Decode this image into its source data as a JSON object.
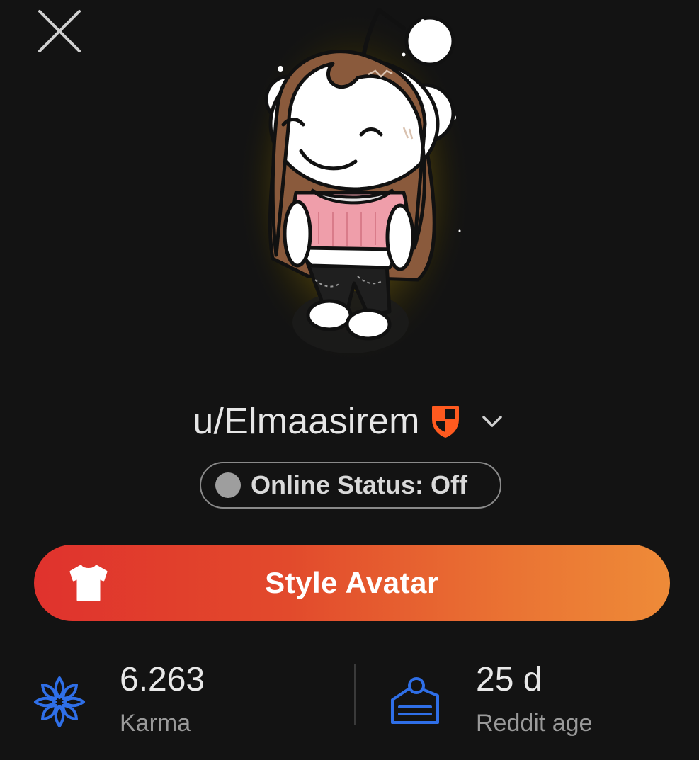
{
  "header": {
    "close_icon": "close-icon"
  },
  "profile": {
    "username": "u/Elmaasirem",
    "badge_icon": "shield-badge-icon",
    "dropdown_icon": "chevron-down-icon"
  },
  "online_status": {
    "label": "Online Status: Off",
    "dot_color": "#9e9e9e"
  },
  "style_avatar": {
    "label": "Style Avatar",
    "icon": "shirt-icon",
    "gradient_start": "#e0322d",
    "gradient_end": "#ee8b38"
  },
  "stats": {
    "karma": {
      "value": "6.263",
      "label": "Karma",
      "icon": "karma-flower-icon",
      "icon_color": "#2f6fe8"
    },
    "age": {
      "value": "25 d",
      "label": "Reddit age",
      "icon": "cake-icon",
      "icon_color": "#2f6fe8"
    }
  },
  "colors": {
    "background": "#131313",
    "text_primary": "#e6e6e6",
    "text_secondary": "#9a9a9a",
    "badge_orange": "#ff5a1f"
  }
}
